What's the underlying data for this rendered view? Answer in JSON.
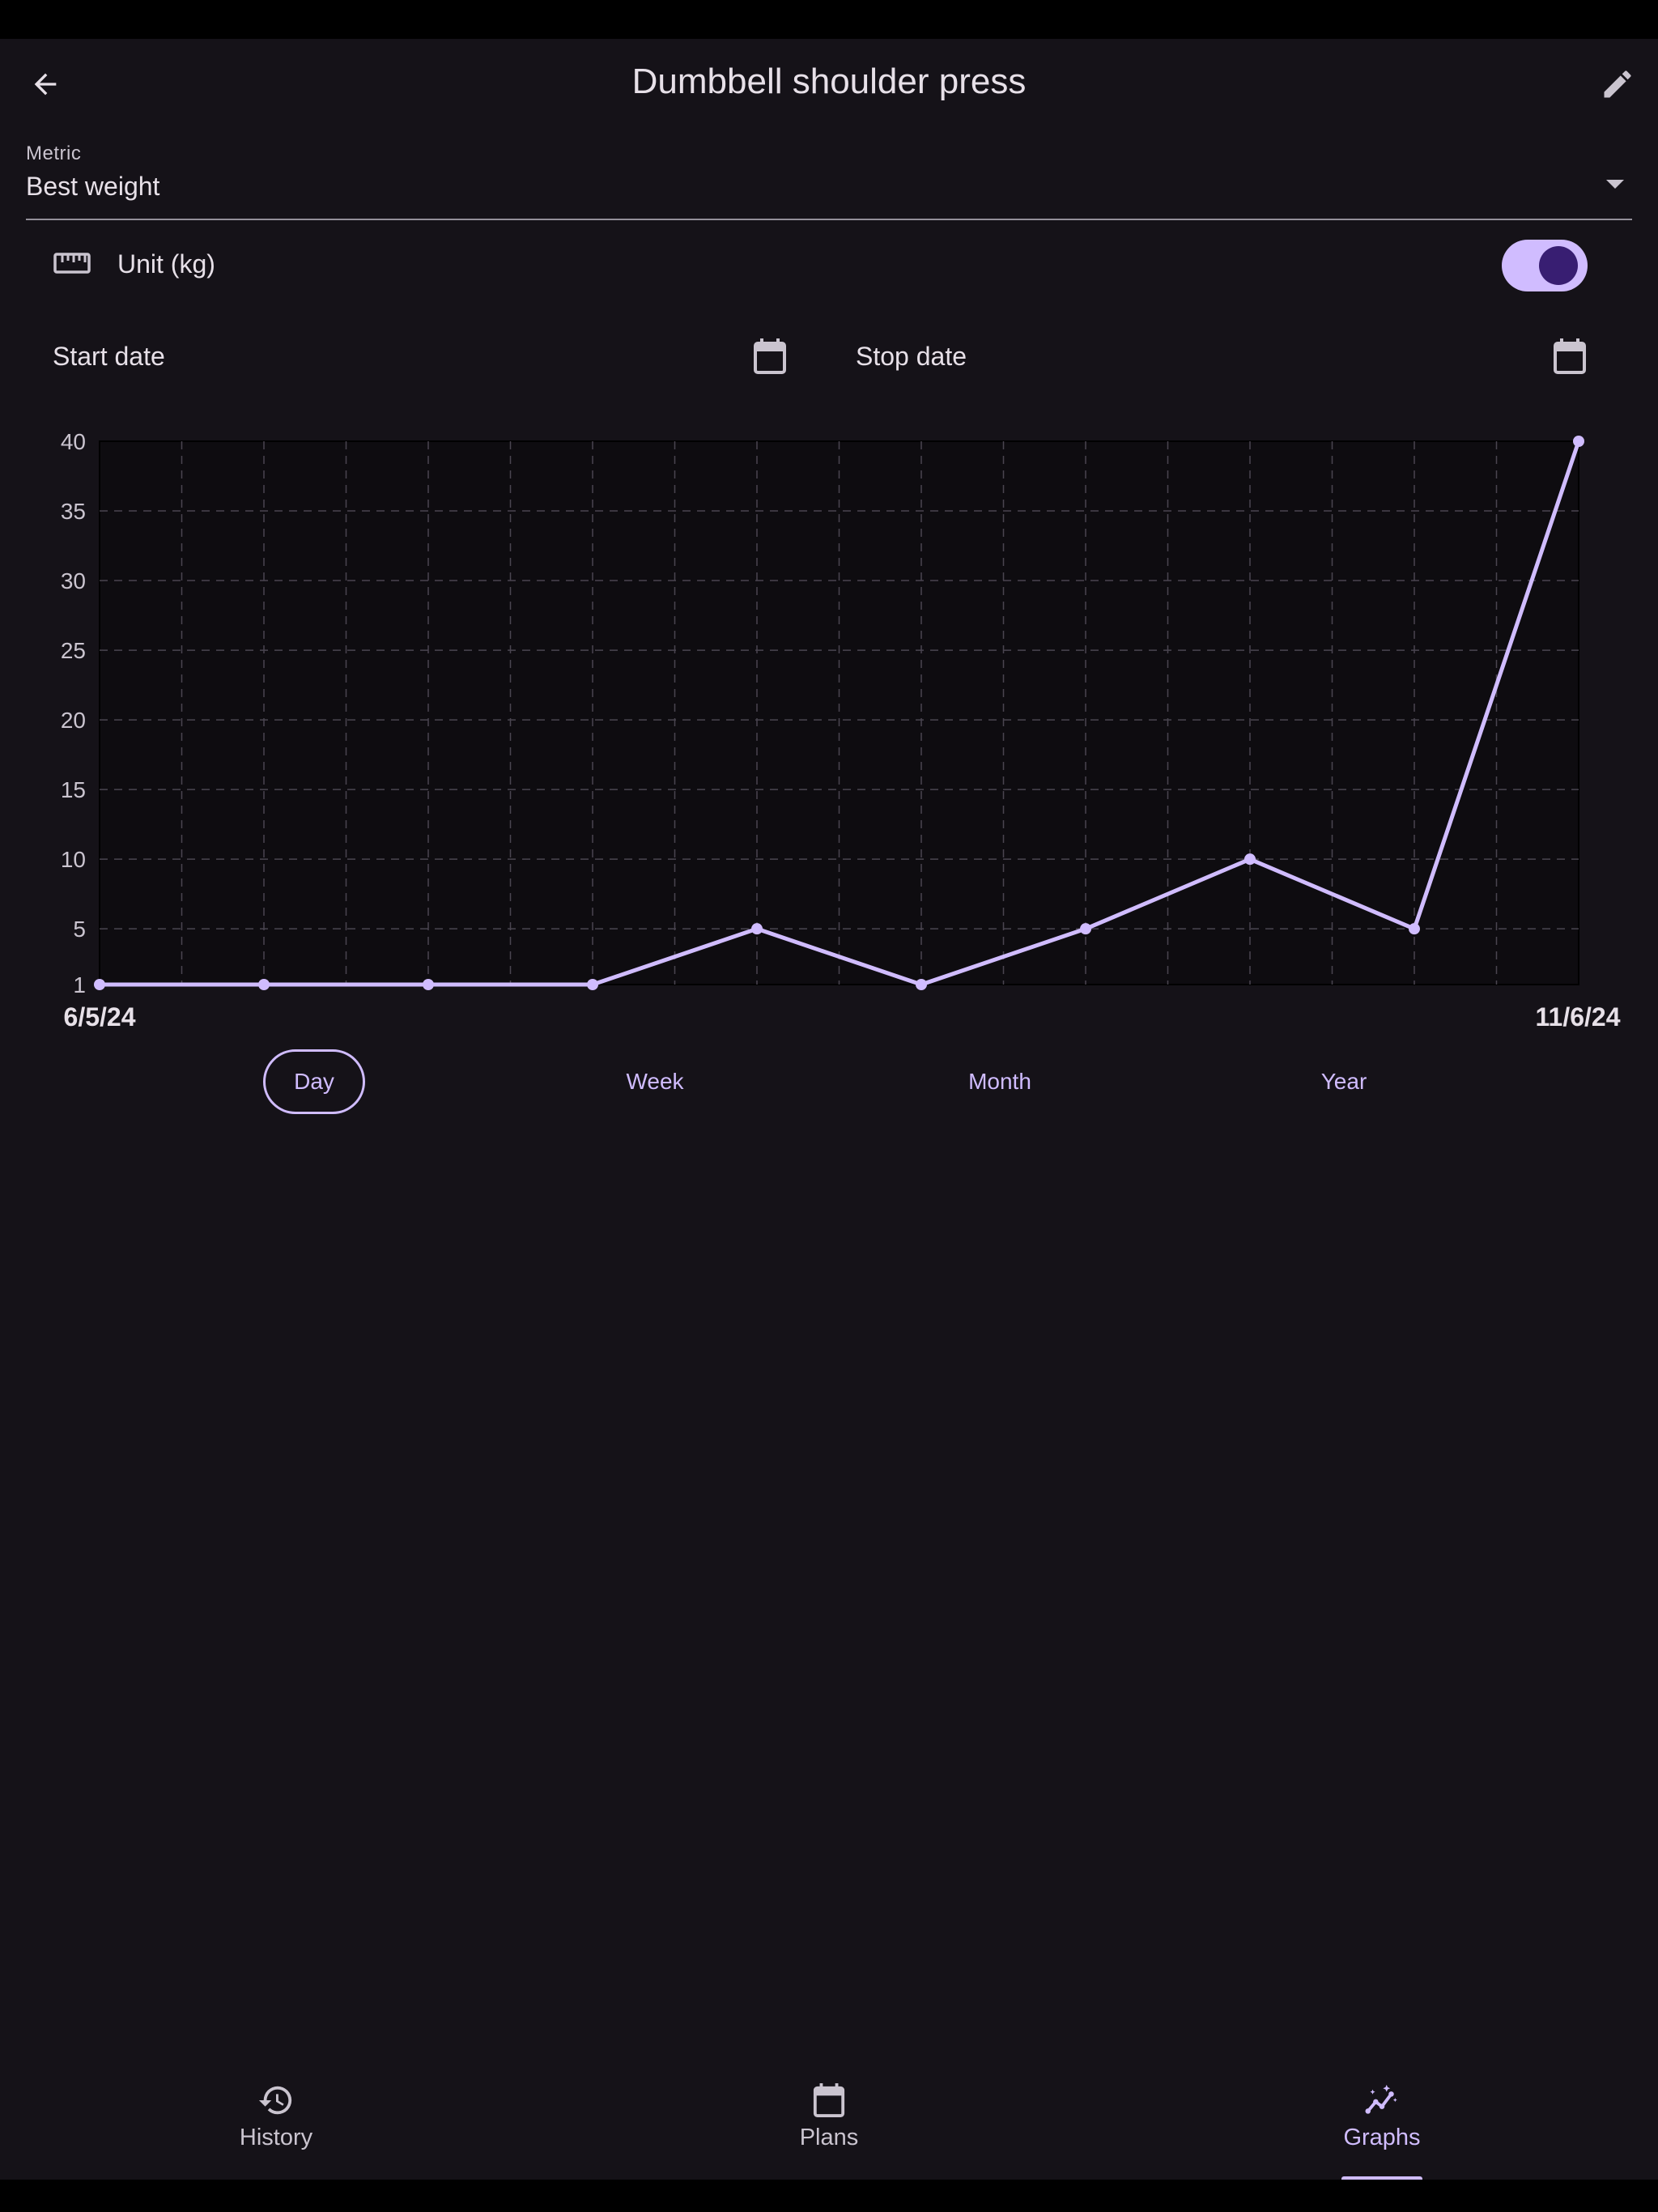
{
  "app_bar": {
    "title": "Dumbbell shoulder press"
  },
  "metric": {
    "label": "Metric",
    "value": "Best weight"
  },
  "unit": {
    "label": "Unit (kg)",
    "enabled": true
  },
  "dates": {
    "start_label": "Start date",
    "stop_label": "Stop date"
  },
  "periods": {
    "day": "Day",
    "week": "Week",
    "month": "Month",
    "year": "Year",
    "selected": "Day"
  },
  "nav": {
    "history": "History",
    "plans": "Plans",
    "graphs": "Graphs",
    "active": "Graphs"
  },
  "colors": {
    "accent": "#d0bcff",
    "background": "#151218",
    "on_surface": "#e7e0e8"
  },
  "chart_data": {
    "type": "line",
    "x_start_label": "6/5/24",
    "x_end_label": "11/6/24",
    "values": [
      1,
      1,
      1,
      1,
      5,
      1,
      5,
      10,
      5,
      40
    ],
    "x_index": [
      0,
      2,
      4,
      6,
      8,
      10,
      12,
      14,
      16,
      18
    ],
    "x_max_index": 18,
    "ylim": [
      1,
      40
    ],
    "yticks": [
      1,
      5,
      10,
      15,
      20,
      25,
      30,
      35,
      40
    ],
    "grid": true,
    "line_color": "#d0bcff"
  }
}
